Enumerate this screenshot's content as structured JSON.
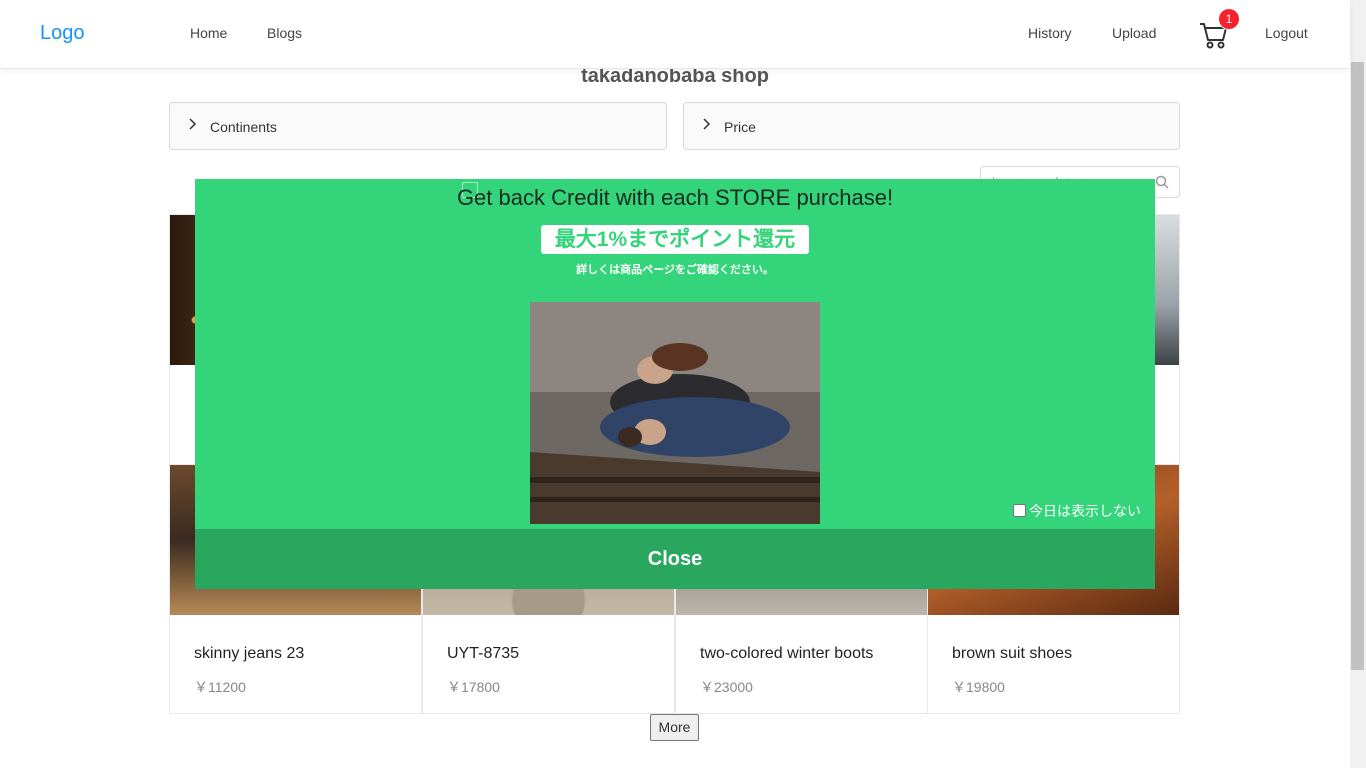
{
  "nav": {
    "logo": "Logo",
    "home": "Home",
    "blogs": "Blogs",
    "history": "History",
    "upload": "Upload",
    "cart_count": "1",
    "logout": "Logout"
  },
  "page": {
    "title": "takadanobaba shop"
  },
  "filters": {
    "continents": "Continents",
    "price": "Price"
  },
  "search": {
    "placeholder": "input search text"
  },
  "products": [
    {
      "title": "skinny jeans 23",
      "price": "￥11200"
    },
    {
      "title": "UYT-8735",
      "price": "￥17800"
    },
    {
      "title": "two-colored winter boots",
      "price": "￥23000"
    },
    {
      "title": "brown suit shoes",
      "price": "￥19800"
    }
  ],
  "more_label": "More",
  "modal": {
    "headline": "Get back Credit with each STORE purchase!",
    "jp_banner": "最大1%までポイント還元",
    "jp_sub": "詳しくは商品ページをご確認ください。",
    "dont_show": "今日は表示しない",
    "close": "Close"
  },
  "colors": {
    "modal_bg": "#33d47a",
    "close_bg": "#2aa75e",
    "accent": "#1890ff",
    "badge": "#f5222d"
  }
}
